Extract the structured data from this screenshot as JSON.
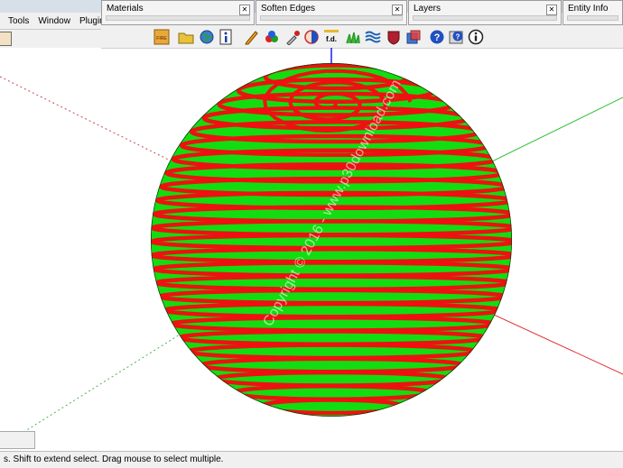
{
  "menu": {
    "items": [
      "Tools",
      "Window",
      "Plugins"
    ]
  },
  "panels": {
    "materials": {
      "title": "Materials"
    },
    "soften_edges": {
      "title": "Soften Edges"
    },
    "layers": {
      "title": "Layers"
    },
    "entity_info": {
      "title": "Entity Info"
    }
  },
  "toolbar": {
    "icons": [
      "fire-icon",
      "folder-icon",
      "globe-icon",
      "info-icon",
      "pencil-icon",
      "paint-bucket-icon",
      "eyedropper-icon",
      "solid-shape-icon",
      "fd-icon",
      "field-icon",
      "wave-icon",
      "shield-icon",
      "export-icon",
      "help-icon",
      "help-book-icon",
      "info-circle-icon"
    ],
    "fire_label": "FIRE",
    "fd_label": "f.d."
  },
  "status": {
    "message": "s. Shift to extend select. Drag mouse to select multiple."
  },
  "watermark": {
    "text": "Copyright © 2016 - www.p30download.com"
  },
  "colors": {
    "accent_red": "#ee1111",
    "accent_green": "#11dd11",
    "axis_blue": "#1a1aff"
  }
}
